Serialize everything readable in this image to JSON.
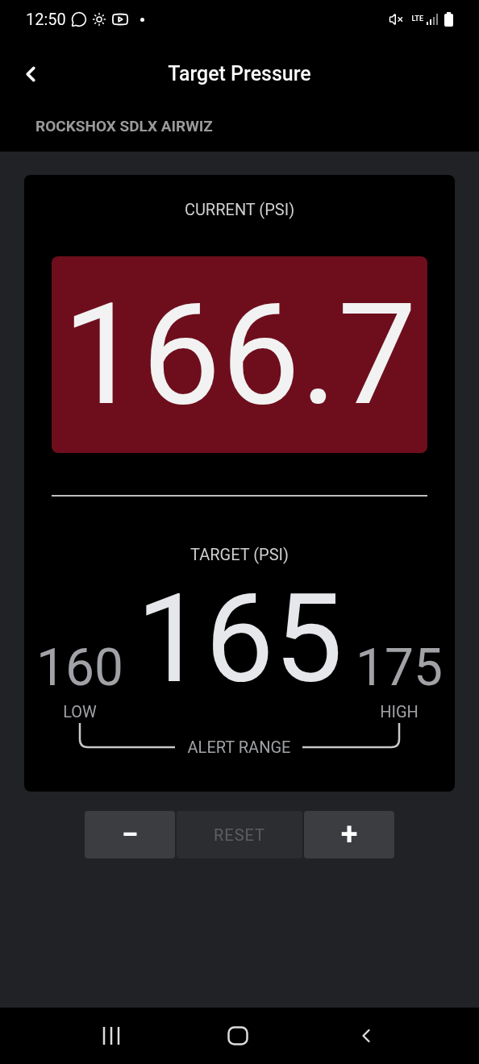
{
  "status_bar": {
    "time": "12:50",
    "network": "LTE"
  },
  "app_bar": {
    "title": "Target Pressure"
  },
  "subtitle": "ROCKSHOX SDLX AIRWIZ",
  "current": {
    "label": "CURRENT (PSI)",
    "value": "166.7",
    "out_of_range": true
  },
  "target": {
    "label": "TARGET (PSI)",
    "value": "165",
    "low": {
      "value": "160",
      "label": "LOW"
    },
    "high": {
      "value": "175",
      "label": "HIGH"
    },
    "range_label": "ALERT RANGE"
  },
  "buttons": [
    {
      "label": "−",
      "kind": "minus",
      "disabled": false
    },
    {
      "label": "RESET",
      "kind": "reset",
      "disabled": true
    },
    {
      "label": "+",
      "kind": "plus",
      "disabled": false
    }
  ]
}
